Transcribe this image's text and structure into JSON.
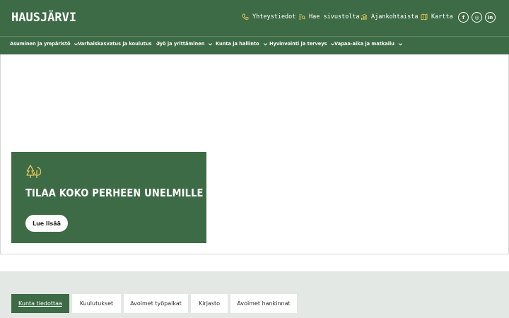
{
  "header": {
    "logo": "HAUSJÄRVI",
    "utility_links": [
      {
        "label": "Yhteystiedot",
        "icon": "phone-icon"
      },
      {
        "label": "Hae sivustolta",
        "icon": "search-list-icon"
      },
      {
        "label": "Ajankohtaista",
        "icon": "news-icon"
      },
      {
        "label": "Kartta",
        "icon": "map-icon"
      }
    ],
    "social": [
      {
        "label": "f",
        "icon": "facebook-icon"
      },
      {
        "label": "◎",
        "icon": "instagram-icon"
      },
      {
        "label": "in",
        "icon": "linkedin-icon"
      }
    ]
  },
  "nav": {
    "items": [
      {
        "label": "Asuminen ja ympäristö"
      },
      {
        "label": "Varhaiskasvatus ja koulutus"
      },
      {
        "label": "Työ ja yrittäminen"
      },
      {
        "label": "Kunta ja hallinto"
      },
      {
        "label": "Hyvinvointi ja terveys"
      },
      {
        "label": "Vapaa-aika ja matkailu"
      }
    ]
  },
  "hero": {
    "icon": "trees-icon",
    "title": "TILAA KOKO PERHEEN UNELMILLE",
    "button_label": "Lue lisää"
  },
  "news": {
    "tabs": [
      {
        "label": "Kunta tiedottaa",
        "active": true
      },
      {
        "label": "Kuulutukset",
        "active": false
      },
      {
        "label": "Avoimet työpaikat",
        "active": false
      },
      {
        "label": "Kirjasto",
        "active": false
      },
      {
        "label": "Avoimet hankinnat",
        "active": false
      }
    ]
  },
  "colors": {
    "brand_green": "#3d6b45",
    "accent_yellow": "#e8c65a",
    "section_bg": "#e3e8e4"
  }
}
